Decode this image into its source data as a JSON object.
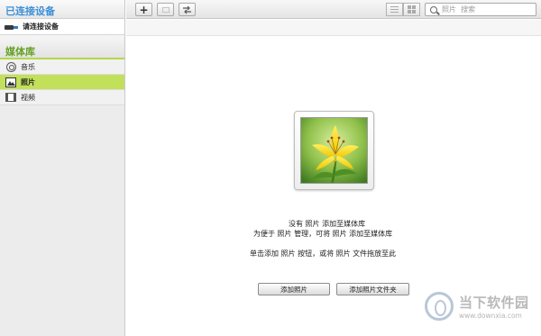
{
  "sidebar": {
    "connected_header": "已连接设备",
    "device_label": "请连接设备",
    "library_header": "媒体库",
    "items": [
      {
        "label": "音乐",
        "icon": "music-icon",
        "selected": false
      },
      {
        "label": "照片",
        "icon": "photo-icon",
        "selected": true
      },
      {
        "label": "视频",
        "icon": "video-icon",
        "selected": false
      }
    ]
  },
  "toolbar": {
    "add_label": "+",
    "search_placeholder": "照片  搜索"
  },
  "main": {
    "empty_line1": "没有  照片  添加至媒体库",
    "empty_line2": "为便于  照片  管理，可将  照片  添加至媒体库",
    "empty_line3": "单击添加  照片  按钮，或将  照片  文件拖放至此",
    "add_photos_button": "添加照片",
    "add_folder_button": "添加照片文件夹"
  },
  "watermark": {
    "title": "当下软件园",
    "url": "www.downxia.com"
  },
  "colors": {
    "accent_blue": "#3e8fd6",
    "library_green": "#62a01f",
    "selected_bg": "#c3e05a"
  }
}
